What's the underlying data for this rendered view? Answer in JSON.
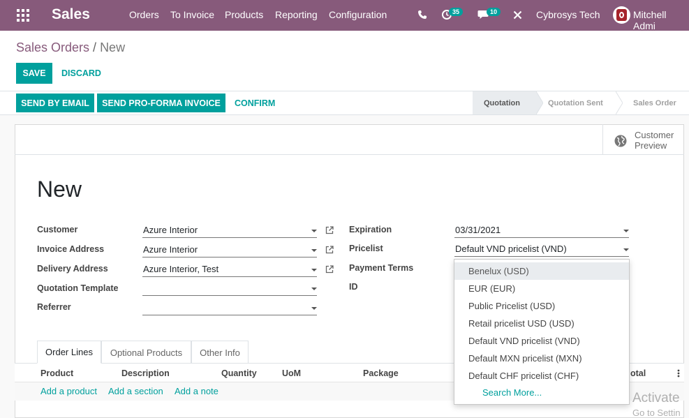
{
  "navbar": {
    "brand": "Sales",
    "menu": [
      "Orders",
      "To Invoice",
      "Products",
      "Reporting",
      "Configuration"
    ],
    "activity_count": "35",
    "message_count": "10",
    "company": "Cybrosys Tech",
    "user": "Mitchell Admi"
  },
  "breadcrumb": {
    "parent": "Sales Orders",
    "separator": "/",
    "current": "New"
  },
  "controls": {
    "save": "Save",
    "discard": "Discard"
  },
  "header_buttons": {
    "send_email": "Send by Email",
    "send_proforma": "Send Pro-Forma Invoice",
    "confirm": "Confirm"
  },
  "stages": [
    "Quotation",
    "Quotation Sent",
    "Sales Order"
  ],
  "smart_button": {
    "line1": "Customer",
    "line2": "Preview"
  },
  "form": {
    "title": "New",
    "left": [
      {
        "label": "Customer",
        "value": "Azure Interior"
      },
      {
        "label": "Invoice Address",
        "value": "Azure Interior"
      },
      {
        "label": "Delivery Address",
        "value": "Azure Interior, Test"
      },
      {
        "label": "Quotation Template",
        "value": ""
      },
      {
        "label": "Referrer",
        "value": ""
      }
    ],
    "right": [
      {
        "label": "Expiration",
        "value": "03/31/2021"
      },
      {
        "label": "Pricelist",
        "value": "Default VND pricelist (VND)"
      },
      {
        "label": "Payment Terms",
        "value": ""
      },
      {
        "label": "ID",
        "value": ""
      }
    ]
  },
  "tabs": [
    "Order Lines",
    "Optional Products",
    "Other Info"
  ],
  "table": {
    "headers": [
      "Product",
      "Description",
      "Quantity",
      "UoM",
      "Package",
      "otal"
    ],
    "add_product": "Add a product",
    "add_section": "Add a section",
    "add_note": "Add a note"
  },
  "pricelist_dropdown": {
    "options": [
      "Benelux (USD)",
      "EUR (EUR)",
      "Public Pricelist (USD)",
      "Retail pricelist USD (USD)",
      "Default VND pricelist (VND)",
      "Default MXN pricelist (MXN)",
      "Default CHF pricelist (CHF)"
    ],
    "search_more": "Search More..."
  },
  "watermark": {
    "line1": "Activate",
    "line2": "Go to Settin"
  },
  "colors": {
    "navbar": "#875a7b",
    "primary": "#00a09d"
  }
}
